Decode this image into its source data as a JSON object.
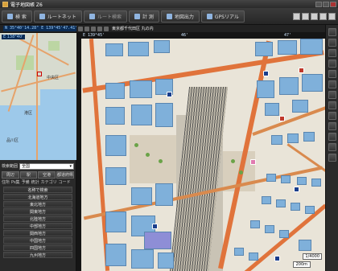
{
  "window": {
    "title": "電子地図帳 Z6"
  },
  "toolbar": {
    "buttons": [
      {
        "label": "検 索"
      },
      {
        "label": "ルートネット"
      },
      {
        "label": "ルート検索"
      },
      {
        "label": "計 測"
      },
      {
        "label": "地図出力"
      },
      {
        "label": "GPSリアル"
      }
    ]
  },
  "left_panel": {
    "coordinate_readout": "N 35°40'14.28\" E 139°45'47.41\"",
    "minimap_coordinate": "E 138°40'",
    "minimap_labels": [
      "中央区",
      "港区",
      "品川区"
    ],
    "search": {
      "label": "検索範囲",
      "value": "全国"
    },
    "tabs": [
      "周辺",
      "駅",
      "空港",
      "都道府県"
    ],
    "subtabs": [
      "住所",
      "Ps集",
      "予備",
      "統計",
      "カテゴリ",
      "コード"
    ],
    "regions": [
      "名称で検索",
      "北海道地方",
      "東北地方",
      "関東地方",
      "北陸地方",
      "中部地方",
      "関西地方",
      "中国地方",
      "四国地方",
      "九州地方"
    ]
  },
  "map_panel": {
    "address": "東京都千代田区 丸の内",
    "ruler": [
      "E 139°45'",
      "46'",
      "47'"
    ],
    "scale_ratio": "1/4000",
    "scale_distance": "200m"
  },
  "colors": {
    "building": "#7fb0da",
    "road": "#e0733b",
    "background": "#e9e4d8"
  }
}
